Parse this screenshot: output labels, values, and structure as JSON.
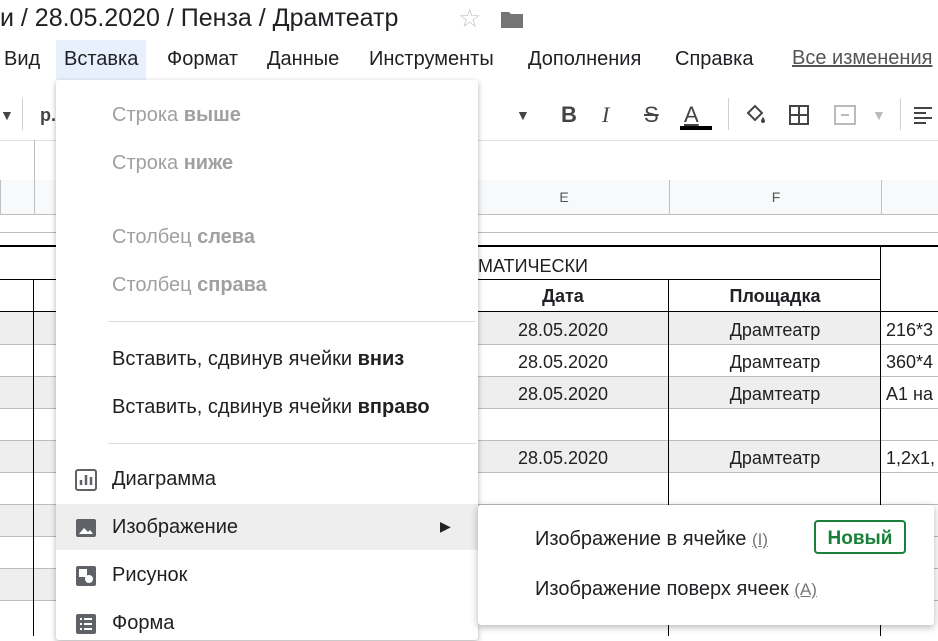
{
  "header": {
    "title": "и / 28.05.2020 / Пенза / Драмтеатр"
  },
  "menubar": {
    "items": [
      "Вид",
      "Вставка",
      "Формат",
      "Данные",
      "Инструменты",
      "Дополнения",
      "Справка"
    ],
    "all_changes": "Все изменения"
  },
  "toolbar": {
    "font_fragment": "р.",
    "bold": "B",
    "italic": "I",
    "strike": "S",
    "text_color": "A",
    "text_color_value": "#000000"
  },
  "sheet": {
    "columns": [
      "E",
      "F"
    ],
    "merged_header": "МАТИЧЕСКИ",
    "headers": [
      "Дата",
      "Площадка"
    ],
    "rows": [
      [
        "28.05.2020",
        "Драмтеатр",
        "216*3"
      ],
      [
        "28.05.2020",
        "Драмтеатр",
        "360*4"
      ],
      [
        "28.05.2020",
        "Драмтеатр",
        "А1 на"
      ],
      [
        "",
        "",
        ""
      ],
      [
        "28.05.2020",
        "Драмтеатр",
        "1,2х1,"
      ]
    ]
  },
  "insert_menu": {
    "row_above": {
      "main": "Строка ",
      "bold": "выше"
    },
    "row_below": {
      "main": "Строка ",
      "bold": "ниже"
    },
    "col_left": {
      "main": "Столбец ",
      "bold": "слева"
    },
    "col_right": {
      "main": "Столбец ",
      "bold": "справа"
    },
    "shift_down": {
      "main": "Вставить, сдвинув ячейки ",
      "bold": "вниз"
    },
    "shift_right": {
      "main": "Вставить, сдвинув ячейки ",
      "bold": "вправо"
    },
    "chart": "Диаграмма",
    "image": "Изображение",
    "drawing": "Рисунок",
    "form": "Форма"
  },
  "image_submenu": {
    "in_cell": "Изображение в ячейке",
    "in_cell_hint": "(I)",
    "new_badge": "Новый",
    "over_cells": "Изображение поверх ячеек",
    "over_cells_hint": "(A)"
  }
}
